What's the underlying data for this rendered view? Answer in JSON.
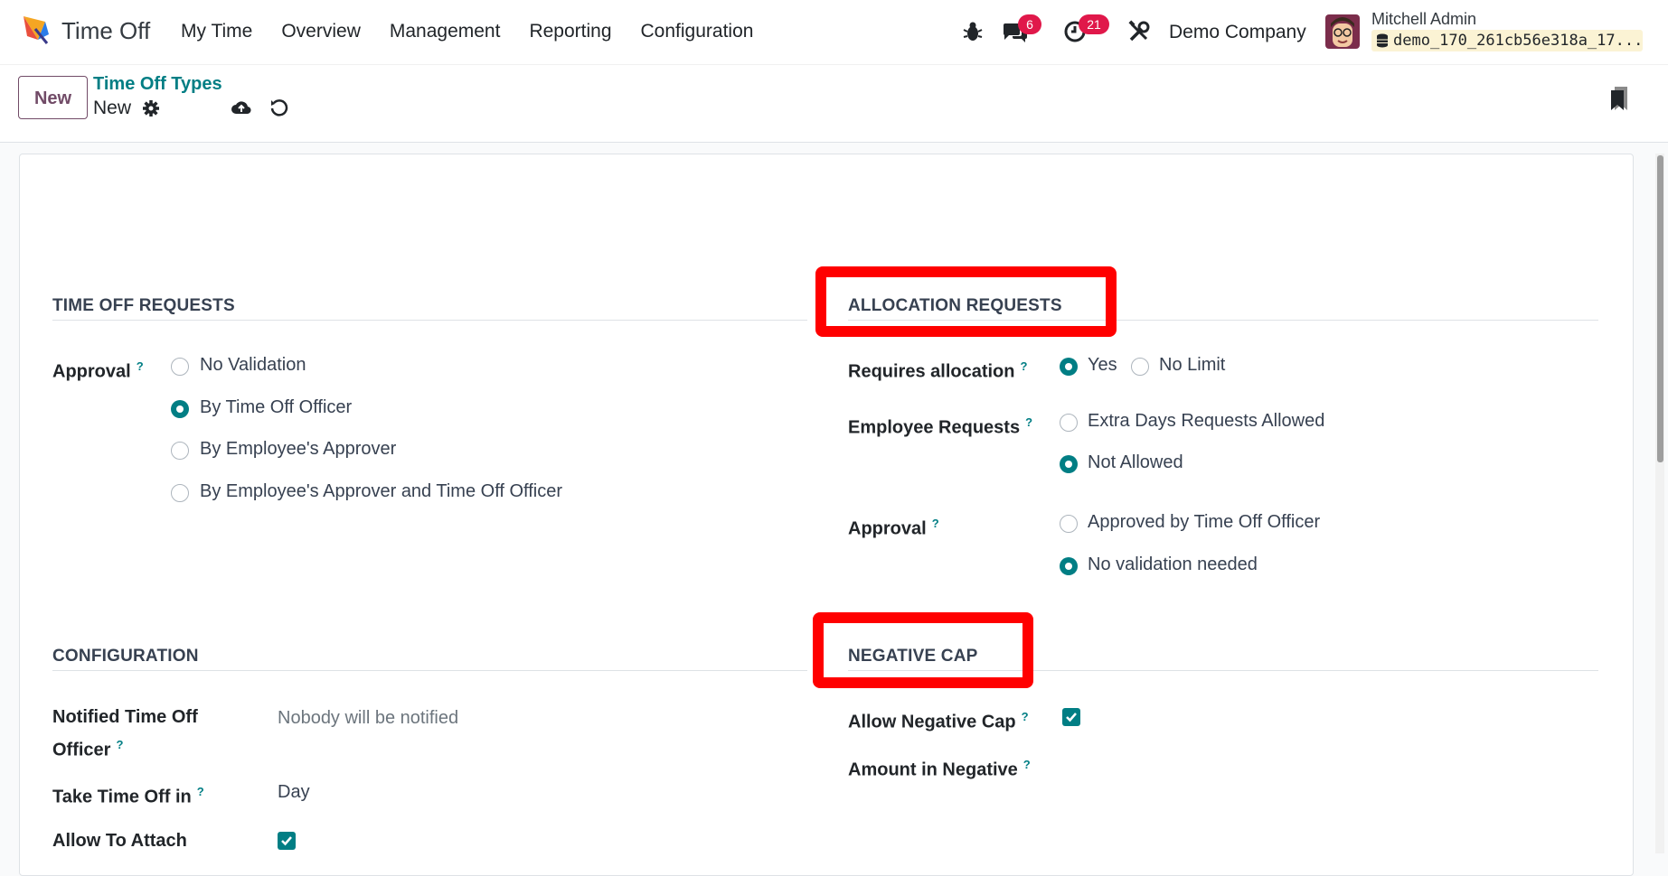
{
  "navbar": {
    "app_name": "Time Off",
    "menu": [
      "My Time",
      "Overview",
      "Management",
      "Reporting",
      "Configuration"
    ],
    "messages_count": "6",
    "activities_count": "21",
    "company": "Demo Company",
    "user_name": "Mitchell Admin",
    "database": "demo_170_261cb56e318a_17..."
  },
  "control_panel": {
    "new_label": "New",
    "breadcrumb": "Time Off Types",
    "record_name": "New"
  },
  "form": {
    "time_off_requests": {
      "title": "TIME OFF REQUESTS",
      "approval_label": "Approval",
      "approval_options": [
        {
          "label": "No Validation",
          "checked": false
        },
        {
          "label": "By Time Off Officer",
          "checked": true
        },
        {
          "label": "By Employee's Approver",
          "checked": false
        },
        {
          "label": "By Employee's Approver and Time Off Officer",
          "checked": false
        }
      ]
    },
    "allocation_requests": {
      "title": "ALLOCATION REQUESTS",
      "requires_allocation_label": "Requires allocation",
      "requires_allocation_options": [
        {
          "label": "Yes",
          "checked": true
        },
        {
          "label": "No Limit",
          "checked": false
        }
      ],
      "employee_requests_label": "Employee Requests",
      "employee_requests_options": [
        {
          "label": "Extra Days Requests Allowed",
          "checked": false
        },
        {
          "label": "Not Allowed",
          "checked": true
        }
      ],
      "approval_label": "Approval",
      "approval_options": [
        {
          "label": "Approved by Time Off Officer",
          "checked": false
        },
        {
          "label": "No validation needed",
          "checked": true
        }
      ]
    },
    "configuration": {
      "title": "CONFIGURATION",
      "notified_label_line1": "Notified Time Off",
      "notified_label_line2": "Officer",
      "notified_placeholder": "Nobody will be notified",
      "take_time_off_label": "Take Time Off in",
      "take_time_off_value": "Day",
      "allow_attach_label": "Allow To Attach",
      "allow_attach_checked": true
    },
    "negative_cap": {
      "title": "NEGATIVE CAP",
      "allow_negative_label": "Allow Negative Cap",
      "allow_negative_checked": true,
      "amount_label": "Amount in Negative"
    },
    "help_marker": "?"
  },
  "colors": {
    "primary": "#714b67",
    "accent": "#017e84",
    "badge": "#e0184a",
    "highlight": "#ff0000"
  }
}
